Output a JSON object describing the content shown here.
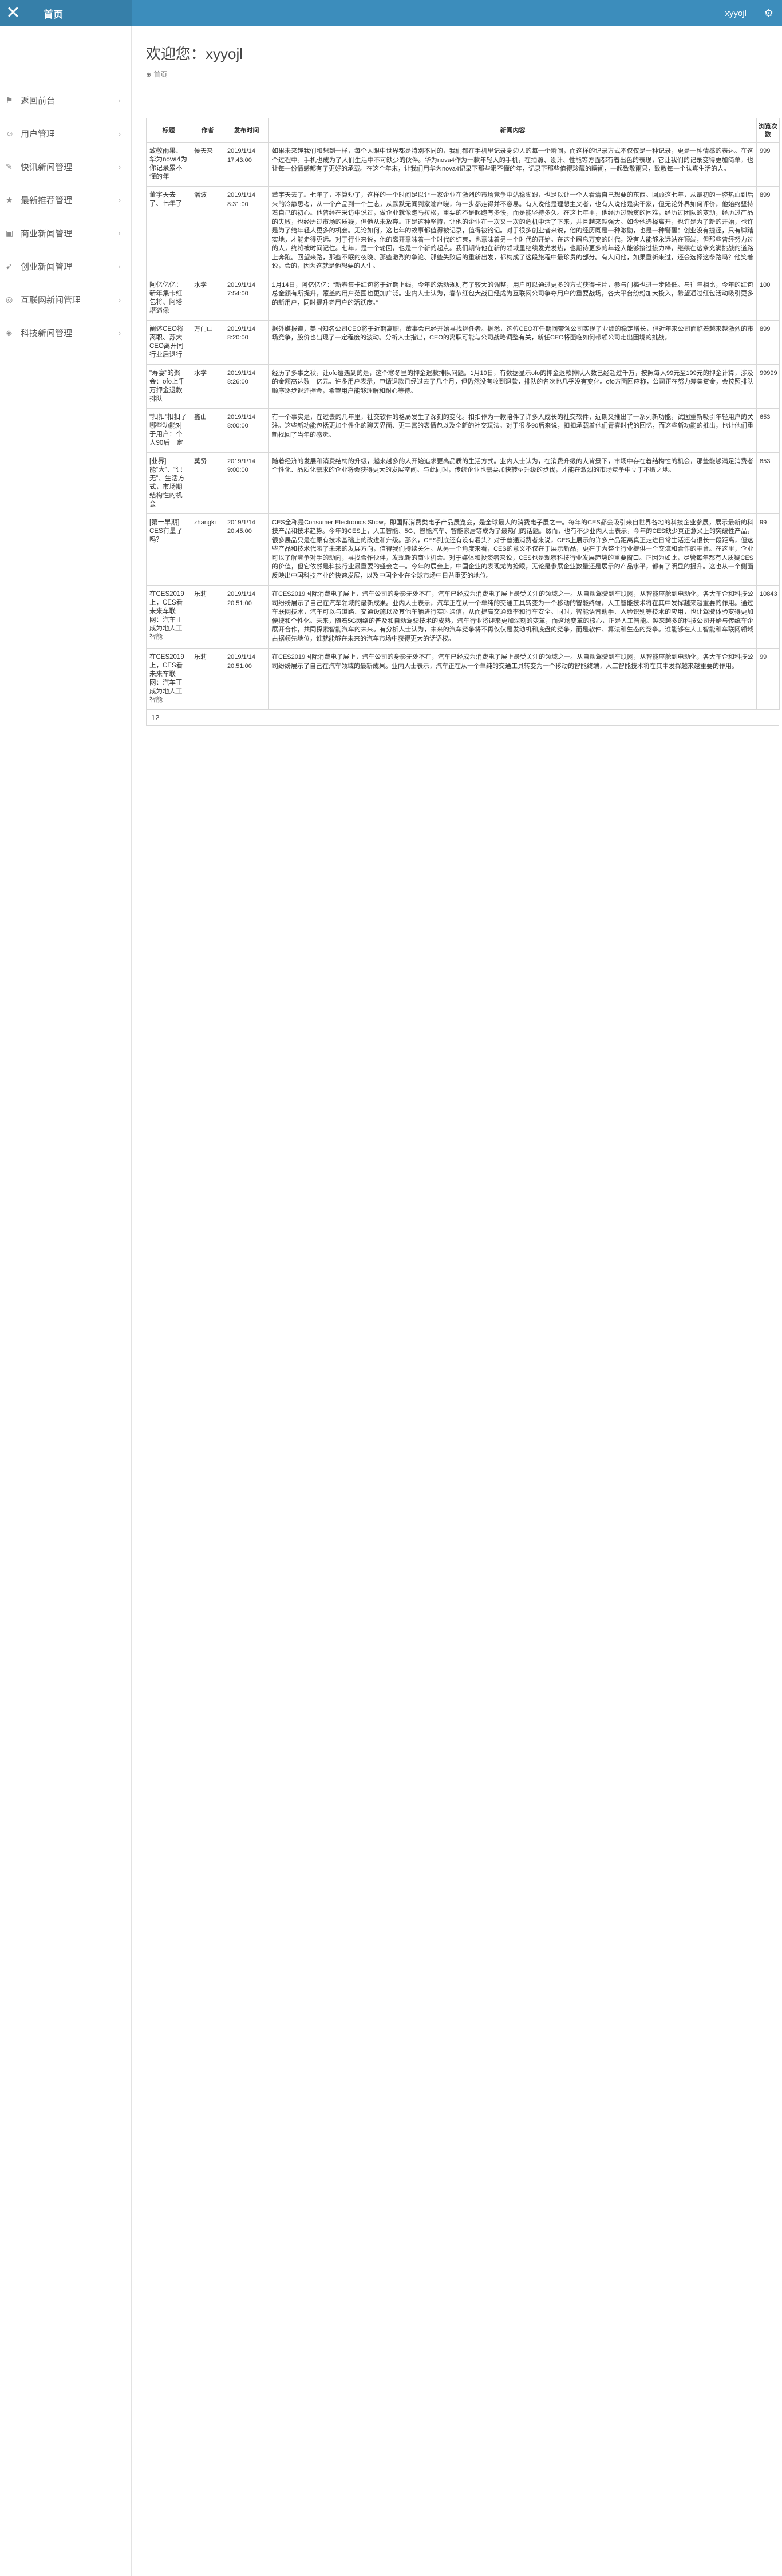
{
  "topbar": {
    "close_icon": "close-icon",
    "title": "首页",
    "user": "xyyojl",
    "gear_icon": "gear-icon"
  },
  "sidebar": {
    "items": [
      {
        "label": "返回前台",
        "icon": "home-icon"
      },
      {
        "label": "用户管理",
        "icon": "user-icon"
      },
      {
        "label": "快讯新闻管理",
        "icon": "news-icon"
      },
      {
        "label": "最新推荐管理",
        "icon": "star-icon"
      },
      {
        "label": "商业新闻管理",
        "icon": "briefcase-icon"
      },
      {
        "label": "创业新闻管理",
        "icon": "rocket-icon"
      },
      {
        "label": "互联网新闻管理",
        "icon": "globe-icon"
      },
      {
        "label": "科技新闻管理",
        "icon": "chip-icon"
      }
    ]
  },
  "header": {
    "welcome": "欢迎您：xyyojl",
    "breadcrumb": "首页"
  },
  "table": {
    "columns": [
      "标题",
      "作者",
      "发布时间",
      "新闻内容",
      "浏览次数"
    ],
    "rows": [
      {
        "title": "致敬雨果、华为nova4为你记录累不懂的年",
        "author": "侯天来",
        "time": "2019/1/14 17:43:00",
        "views": "999",
        "body": "如果未来趣我们和想到一样，每个人眼中世界都是特别不同的，我们都在手机里记录身边人的每一个瞬间，而这样的记录方式不仅仅是一种记录，更是一种情感的表达。在这个过程中，手机也成为了人们生活中不可缺少的伙伴。华为nova4作为一款年轻人的手机，在拍照、设计、性能等方面都有着出色的表现，它让我们的记录变得更加简单，也让每一份情感都有了更好的承载。在这个年末，让我们用华为nova4记录下那些累不懂的年，记录下那些值得珍藏的瞬间，一起致敬雨果，致敬每一个认真生活的人。"
      },
      {
        "title": "董宇天去了、七年了",
        "author": "潘波",
        "time": "2019/1/14 8:31:00",
        "views": "899",
        "body": "董宇天去了。七年了，不算短了，这样的一个时间足以让一家企业在激烈的市场竞争中站稳脚跟，也足以让一个人看清自己想要的东西。回顾这七年，从最初的一腔热血到后来的冷静思考，从一个产品到一个生态，从默默无闻到家喻户晓，每一步都走得并不容易。有人说他是理想主义者，也有人说他是实干家，但无论外界如何评价，他始终坚持着自己的初心。他曾经在采访中说过，做企业就像跑马拉松，重要的不是起跑有多快，而是能坚持多久。在这七年里，他经历过融资的困难，经历过团队的变动，经历过产品的失败，也经历过市场的质疑，但他从未放弃。正是这种坚持，让他的企业在一次又一次的危机中活了下来，并且越来越强大。如今他选择离开，也许是为了新的开始，也许是为了给年轻人更多的机会。无论如何，这七年的故事都值得被记录，值得被铭记。对于很多创业者来说，他的经历既是一种激励，也是一种警醒：创业没有捷径，只有脚踏实地，才能走得更远。对于行业来说，他的离开意味着一个时代的结束，也意味着另一个时代的开始。在这个瞬息万变的时代，没有人能够永远站在顶端，但那些曾经努力过的人，终将被时间记住。七年，是一个轮回，也是一个新的起点。我们期待他在新的领域里继续发光发热，也期待更多的年轻人能够接过接力棒，继续在这条充满挑战的道路上奔跑。回望来路，那些不眠的夜晚、那些激烈的争论、那些失败后的重新出发，都构成了这段旅程中最珍贵的部分。有人问他，如果重新来过，还会选择这条路吗？他笑着说，会的，因为这就是他想要的人生。"
      },
      {
        "title": "阿亿亿亿：新年集卡红包将、阿塔塔遇像",
        "author": "水学",
        "time": "2019/1/14 7:54:00",
        "views": "100",
        "body": "1月14日，阿亿亿亿：“新春集卡红包将于近期上线，今年的活动规则有了较大的调整，用户可以通过更多的方式获得卡片，参与门槛也进一步降低。与往年相比，今年的红包总金额有所提升，覆盖的用户范围也更加广泛。业内人士认为，春节红包大战已经成为互联网公司争夺用户的重要战场，各大平台纷纷加大投入，希望通过红包活动吸引更多的新用户，同时提升老用户的活跃度。”"
      },
      {
        "title": "阐述CEO将离职、苏大CEO离开同行业后退行",
        "author": "万门山",
        "time": "2019/1/14 8:20:00",
        "views": "899",
        "body": "据外媒报道，美国知名公司CEO将于近期离职，董事会已经开始寻找继任者。据悉，这位CEO在任期间带领公司实现了业绩的稳定增长，但近年来公司面临着越来越激烈的市场竞争，股价也出现了一定程度的波动。分析人士指出，CEO的离职可能与公司战略调整有关，新任CEO将面临如何带领公司走出困境的挑战。"
      },
      {
        "title": "\"寿宴\"的聚会：ofo上千万押金退款排队",
        "author": "水学",
        "time": "2019/1/14 8:26:00",
        "views": "99999",
        "body": "经历了多事之秋，让ofo遭遇到的是，这个寒冬里的押金退款排队问题。1月10日，有数据显示ofo的押金退款排队人数已经超过千万，按照每人99元至199元的押金计算，涉及的金额高达数十亿元。许多用户表示，申请退款已经过去了几个月，但仍然没有收到退款，排队的名次也几乎没有变化。ofo方面回应称，公司正在努力筹集资金，会按照排队顺序逐步退还押金，希望用户能够理解和耐心等待。"
      },
      {
        "title": "\"扣扣\"扣扣了哪些功能对于用户：个人90后一定",
        "author": "鑫山",
        "time": "2019/1/14 8:00:00",
        "views": "653",
        "body": "有一个事实是，在过去的几年里，社交软件的格局发生了深刻的变化。扣扣作为一款陪伴了许多人成长的社交软件，近期又推出了一系列新功能，试图重新吸引年轻用户的关注。这些新功能包括更加个性化的聊天界面、更丰富的表情包以及全新的社交玩法。对于很多90后来说，扣扣承载着他们青春时代的回忆，而这些新功能的推出，也让他们重新找回了当年的感觉。"
      },
      {
        "title": "[业界] 能“大”、“记无”、生活方式，市场期结构性的机会",
        "author": "莫贤",
        "time": "2019/1/14 9:00:00",
        "views": "853",
        "body": "随着经济的发展和消费结构的升级，越来越多的人开始追求更高品质的生活方式。业内人士认为，在消费升级的大背景下，市场中存在着结构性的机会，那些能够满足消费者个性化、品质化需求的企业将会获得更大的发展空间。与此同时，传统企业也需要加快转型升级的步伐，才能在激烈的市场竞争中立于不败之地。"
      },
      {
        "title": "[第一早期] CES有量了吗？",
        "author": "zhangki",
        "time": "2019/1/14 20:45:00",
        "views": "99",
        "body": "CES全称是Consumer Electronics Show，即国际消费类电子产品展览会，是全球最大的消费电子展之一。每年的CES都会吸引来自世界各地的科技企业参展，展示最新的科技产品和技术趋势。今年的CES上，人工智能、5G、智能汽车、智能家居等成为了最热门的话题。然而，也有不少业内人士表示，今年的CES缺少真正意义上的突破性产品，很多展品只是在原有技术基础上的改进和升级。那么，CES到底还有没有看头？对于普通消费者来说，CES上展示的许多产品距离真正走进日常生活还有很长一段距离，但这些产品和技术代表了未来的发展方向，值得我们持续关注。从另一个角度来看，CES的意义不仅在于展示新品，更在于为整个行业提供一个交流和合作的平台。在这里，企业可以了解竞争对手的动向，寻找合作伙伴，发现新的商业机会。对于媒体和投资者来说，CES也是观察科技行业发展趋势的重要窗口。正因为如此，尽管每年都有人质疑CES的价值，但它依然是科技行业最重要的盛会之一。今年的展会上，中国企业的表现尤为抢眼，无论是参展企业数量还是展示的产品水平，都有了明显的提升。这也从一个侧面反映出中国科技产业的快速发展，以及中国企业在全球市场中日益重要的地位。"
      },
      {
        "title": "在CES2019上，CES看未来车联网：汽车正成为地人工智能",
        "author": "乐莉",
        "time": "2019/1/14 20:51:00",
        "views": "10843",
        "body": "在CES2019国际消费电子展上，汽车公司的身影无处不在，汽车已经成为消费电子展上最受关注的领域之一。从自动驾驶到车联网，从智能座舱到电动化，各大车企和科技公司纷纷展示了自己在汽车领域的最新成果。业内人士表示，汽车正在从一个单纯的交通工具转变为一个移动的智能终端，人工智能技术将在其中发挥越来越重要的作用。通过车联网技术，汽车可以与道路、交通设施以及其他车辆进行实时通信，从而提高交通效率和行车安全。同时，智能语音助手、人脸识别等技术的应用，也让驾驶体验变得更加便捷和个性化。未来，随着5G网络的普及和自动驾驶技术的成熟，汽车行业将迎来更加深刻的变革，而这场变革的核心，正是人工智能。越来越多的科技公司开始与传统车企展开合作，共同探索智能汽车的未来。有分析人士认为，未来的汽车竞争将不再仅仅是发动机和底盘的竞争，而是软件、算法和生态的竞争。谁能够在人工智能和车联网领域占据领先地位，谁就能够在未来的汽车市场中获得更大的话语权。"
      },
      {
        "title": "在CES2019上，CES看未来车联网：汽车正成为地人工智能",
        "author": "乐莉",
        "time": "2019/1/14 20:51:00",
        "views": "99",
        "body": "在CES2019国际消费电子展上，汽车公司的身影无处不在，汽车已经成为消费电子展上最受关注的领域之一。从自动驾驶到车联网，从智能座舱到电动化，各大车企和科技公司纷纷展示了自己在汽车领域的最新成果。业内人士表示，汽车正在从一个单纯的交通工具转变为一个移动的智能终端，人工智能技术将在其中发挥越来越重要的作用。"
      }
    ],
    "total": "12"
  }
}
